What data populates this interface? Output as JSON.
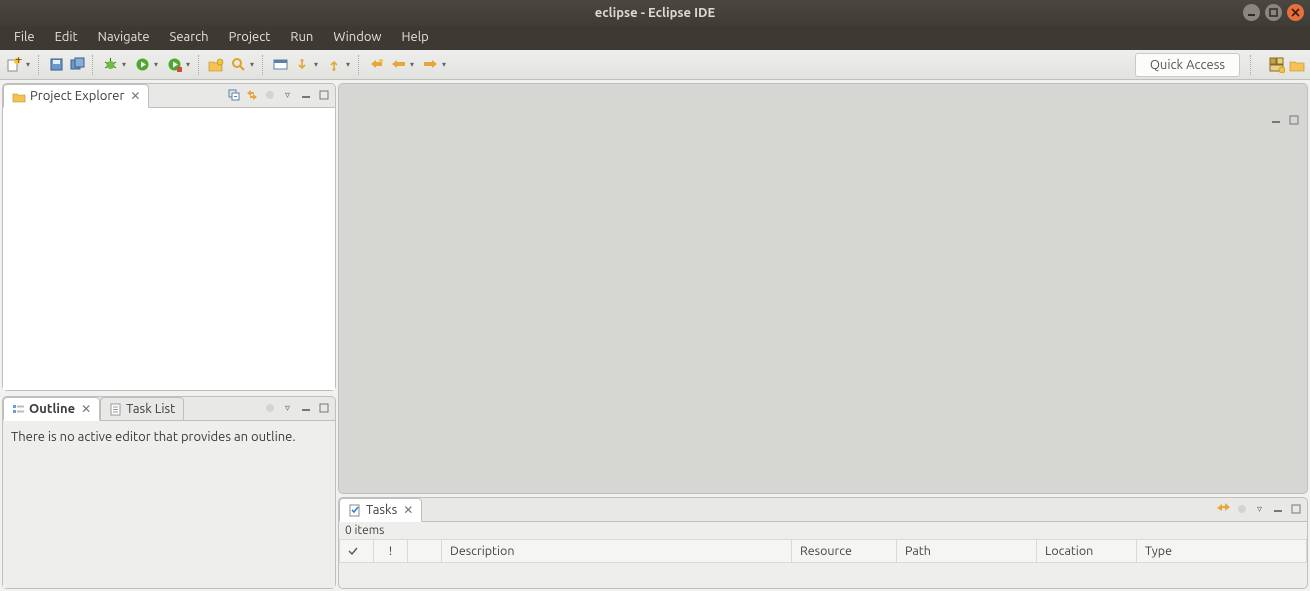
{
  "window": {
    "title": "eclipse - Eclipse IDE"
  },
  "menus": [
    "File",
    "Edit",
    "Navigate",
    "Search",
    "Project",
    "Run",
    "Window",
    "Help"
  ],
  "quick_access": {
    "label": "Quick Access"
  },
  "views": {
    "project_explorer": {
      "title": "Project Explorer"
    },
    "outline": {
      "title": "Outline",
      "message": "There is no active editor that provides an outline."
    },
    "task_list": {
      "title": "Task List"
    },
    "tasks": {
      "title": "Tasks",
      "count": "0 items",
      "columns": [
        "",
        "!",
        "",
        "Description",
        "Resource",
        "Path",
        "Location",
        "Type"
      ]
    }
  }
}
